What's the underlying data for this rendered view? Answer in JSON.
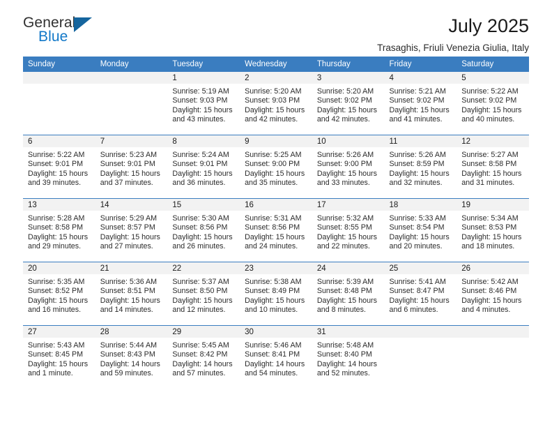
{
  "brand": {
    "name_part1": "General",
    "name_part2": "Blue",
    "accent_color": "#1278c8",
    "triangle_color": "#15659e"
  },
  "header": {
    "title": "July 2025",
    "subtitle": "Trasaghis, Friuli Venezia Giulia, Italy",
    "header_bg_color": "#3a7dc0",
    "daynum_bg_color": "#f2f2f2"
  },
  "weekdays": [
    "Sunday",
    "Monday",
    "Tuesday",
    "Wednesday",
    "Thursday",
    "Friday",
    "Saturday"
  ],
  "weeks": [
    [
      {
        "day": ""
      },
      {
        "day": ""
      },
      {
        "day": "1",
        "sunrise": "Sunrise: 5:19 AM",
        "sunset": "Sunset: 9:03 PM",
        "daylight_line1": "Daylight: 15 hours",
        "daylight_line2": "and 43 minutes."
      },
      {
        "day": "2",
        "sunrise": "Sunrise: 5:20 AM",
        "sunset": "Sunset: 9:03 PM",
        "daylight_line1": "Daylight: 15 hours",
        "daylight_line2": "and 42 minutes."
      },
      {
        "day": "3",
        "sunrise": "Sunrise: 5:20 AM",
        "sunset": "Sunset: 9:02 PM",
        "daylight_line1": "Daylight: 15 hours",
        "daylight_line2": "and 42 minutes."
      },
      {
        "day": "4",
        "sunrise": "Sunrise: 5:21 AM",
        "sunset": "Sunset: 9:02 PM",
        "daylight_line1": "Daylight: 15 hours",
        "daylight_line2": "and 41 minutes."
      },
      {
        "day": "5",
        "sunrise": "Sunrise: 5:22 AM",
        "sunset": "Sunset: 9:02 PM",
        "daylight_line1": "Daylight: 15 hours",
        "daylight_line2": "and 40 minutes."
      }
    ],
    [
      {
        "day": "6",
        "sunrise": "Sunrise: 5:22 AM",
        "sunset": "Sunset: 9:01 PM",
        "daylight_line1": "Daylight: 15 hours",
        "daylight_line2": "and 39 minutes."
      },
      {
        "day": "7",
        "sunrise": "Sunrise: 5:23 AM",
        "sunset": "Sunset: 9:01 PM",
        "daylight_line1": "Daylight: 15 hours",
        "daylight_line2": "and 37 minutes."
      },
      {
        "day": "8",
        "sunrise": "Sunrise: 5:24 AM",
        "sunset": "Sunset: 9:01 PM",
        "daylight_line1": "Daylight: 15 hours",
        "daylight_line2": "and 36 minutes."
      },
      {
        "day": "9",
        "sunrise": "Sunrise: 5:25 AM",
        "sunset": "Sunset: 9:00 PM",
        "daylight_line1": "Daylight: 15 hours",
        "daylight_line2": "and 35 minutes."
      },
      {
        "day": "10",
        "sunrise": "Sunrise: 5:26 AM",
        "sunset": "Sunset: 9:00 PM",
        "daylight_line1": "Daylight: 15 hours",
        "daylight_line2": "and 33 minutes."
      },
      {
        "day": "11",
        "sunrise": "Sunrise: 5:26 AM",
        "sunset": "Sunset: 8:59 PM",
        "daylight_line1": "Daylight: 15 hours",
        "daylight_line2": "and 32 minutes."
      },
      {
        "day": "12",
        "sunrise": "Sunrise: 5:27 AM",
        "sunset": "Sunset: 8:58 PM",
        "daylight_line1": "Daylight: 15 hours",
        "daylight_line2": "and 31 minutes."
      }
    ],
    [
      {
        "day": "13",
        "sunrise": "Sunrise: 5:28 AM",
        "sunset": "Sunset: 8:58 PM",
        "daylight_line1": "Daylight: 15 hours",
        "daylight_line2": "and 29 minutes."
      },
      {
        "day": "14",
        "sunrise": "Sunrise: 5:29 AM",
        "sunset": "Sunset: 8:57 PM",
        "daylight_line1": "Daylight: 15 hours",
        "daylight_line2": "and 27 minutes."
      },
      {
        "day": "15",
        "sunrise": "Sunrise: 5:30 AM",
        "sunset": "Sunset: 8:56 PM",
        "daylight_line1": "Daylight: 15 hours",
        "daylight_line2": "and 26 minutes."
      },
      {
        "day": "16",
        "sunrise": "Sunrise: 5:31 AM",
        "sunset": "Sunset: 8:56 PM",
        "daylight_line1": "Daylight: 15 hours",
        "daylight_line2": "and 24 minutes."
      },
      {
        "day": "17",
        "sunrise": "Sunrise: 5:32 AM",
        "sunset": "Sunset: 8:55 PM",
        "daylight_line1": "Daylight: 15 hours",
        "daylight_line2": "and 22 minutes."
      },
      {
        "day": "18",
        "sunrise": "Sunrise: 5:33 AM",
        "sunset": "Sunset: 8:54 PM",
        "daylight_line1": "Daylight: 15 hours",
        "daylight_line2": "and 20 minutes."
      },
      {
        "day": "19",
        "sunrise": "Sunrise: 5:34 AM",
        "sunset": "Sunset: 8:53 PM",
        "daylight_line1": "Daylight: 15 hours",
        "daylight_line2": "and 18 minutes."
      }
    ],
    [
      {
        "day": "20",
        "sunrise": "Sunrise: 5:35 AM",
        "sunset": "Sunset: 8:52 PM",
        "daylight_line1": "Daylight: 15 hours",
        "daylight_line2": "and 16 minutes."
      },
      {
        "day": "21",
        "sunrise": "Sunrise: 5:36 AM",
        "sunset": "Sunset: 8:51 PM",
        "daylight_line1": "Daylight: 15 hours",
        "daylight_line2": "and 14 minutes."
      },
      {
        "day": "22",
        "sunrise": "Sunrise: 5:37 AM",
        "sunset": "Sunset: 8:50 PM",
        "daylight_line1": "Daylight: 15 hours",
        "daylight_line2": "and 12 minutes."
      },
      {
        "day": "23",
        "sunrise": "Sunrise: 5:38 AM",
        "sunset": "Sunset: 8:49 PM",
        "daylight_line1": "Daylight: 15 hours",
        "daylight_line2": "and 10 minutes."
      },
      {
        "day": "24",
        "sunrise": "Sunrise: 5:39 AM",
        "sunset": "Sunset: 8:48 PM",
        "daylight_line1": "Daylight: 15 hours",
        "daylight_line2": "and 8 minutes."
      },
      {
        "day": "25",
        "sunrise": "Sunrise: 5:41 AM",
        "sunset": "Sunset: 8:47 PM",
        "daylight_line1": "Daylight: 15 hours",
        "daylight_line2": "and 6 minutes."
      },
      {
        "day": "26",
        "sunrise": "Sunrise: 5:42 AM",
        "sunset": "Sunset: 8:46 PM",
        "daylight_line1": "Daylight: 15 hours",
        "daylight_line2": "and 4 minutes."
      }
    ],
    [
      {
        "day": "27",
        "sunrise": "Sunrise: 5:43 AM",
        "sunset": "Sunset: 8:45 PM",
        "daylight_line1": "Daylight: 15 hours",
        "daylight_line2": "and 1 minute."
      },
      {
        "day": "28",
        "sunrise": "Sunrise: 5:44 AM",
        "sunset": "Sunset: 8:43 PM",
        "daylight_line1": "Daylight: 14 hours",
        "daylight_line2": "and 59 minutes."
      },
      {
        "day": "29",
        "sunrise": "Sunrise: 5:45 AM",
        "sunset": "Sunset: 8:42 PM",
        "daylight_line1": "Daylight: 14 hours",
        "daylight_line2": "and 57 minutes."
      },
      {
        "day": "30",
        "sunrise": "Sunrise: 5:46 AM",
        "sunset": "Sunset: 8:41 PM",
        "daylight_line1": "Daylight: 14 hours",
        "daylight_line2": "and 54 minutes."
      },
      {
        "day": "31",
        "sunrise": "Sunrise: 5:48 AM",
        "sunset": "Sunset: 8:40 PM",
        "daylight_line1": "Daylight: 14 hours",
        "daylight_line2": "and 52 minutes."
      },
      {
        "day": ""
      },
      {
        "day": ""
      }
    ]
  ]
}
